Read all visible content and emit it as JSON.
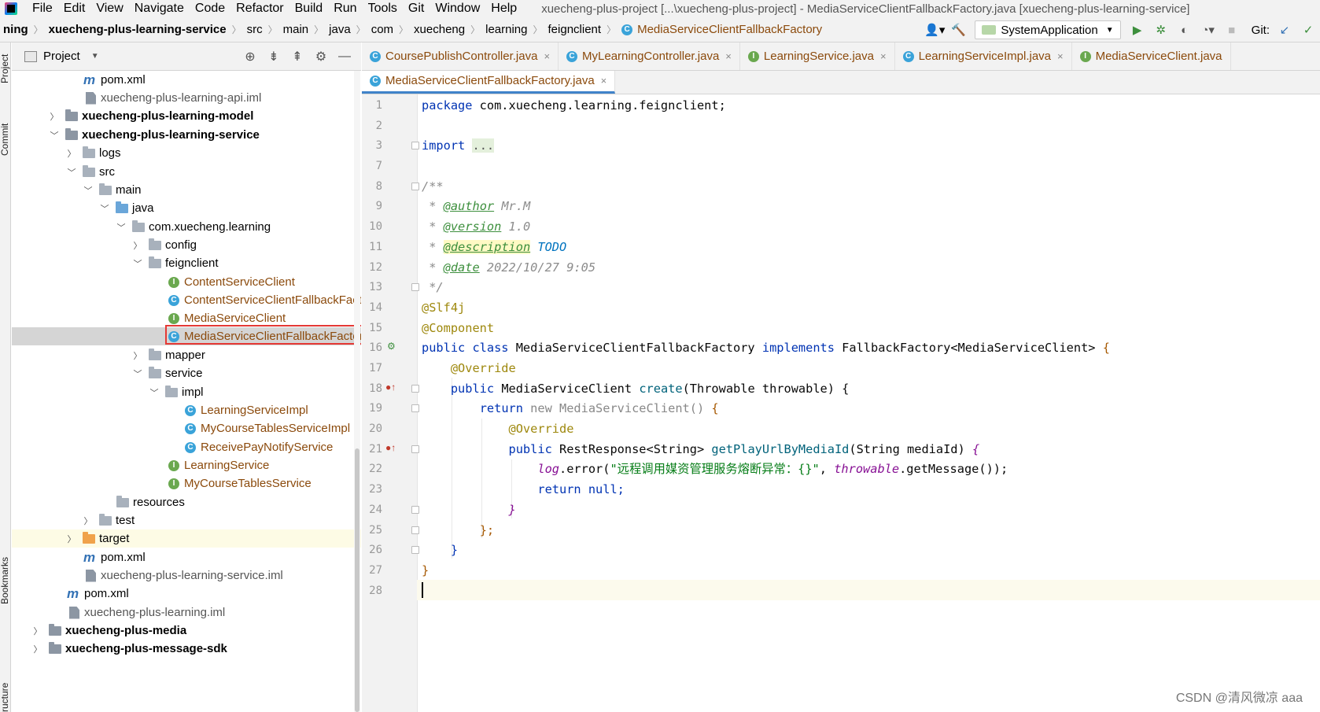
{
  "menubar": {
    "items": [
      "File",
      "Edit",
      "View",
      "Navigate",
      "Code",
      "Refactor",
      "Build",
      "Run",
      "Tools",
      "Git",
      "Window",
      "Help"
    ],
    "window_title": "xuecheng-plus-project [...\\xuecheng-plus-project] - MediaServiceClientFallbackFactory.java [xuecheng-plus-learning-service]"
  },
  "breadcrumb": [
    "ning",
    "xuecheng-plus-learning-service",
    "src",
    "main",
    "java",
    "com",
    "xuecheng",
    "learning",
    "feignclient",
    "MediaServiceClientFallbackFactory"
  ],
  "toolbar": {
    "run_config": "SystemApplication",
    "git_label": "Git:"
  },
  "left_strip": {
    "labels": [
      "Project",
      "Commit",
      "Bookmarks",
      "ructure"
    ]
  },
  "project_panel": {
    "title": "Project"
  },
  "tree": [
    {
      "label": "pom.xml",
      "type": "maven"
    },
    {
      "label": "xuecheng-plus-learning-api.iml",
      "type": "iml"
    },
    {
      "label": "xuecheng-plus-learning-model",
      "type": "module"
    },
    {
      "label": "xuecheng-plus-learning-service",
      "type": "module"
    },
    {
      "label": "logs",
      "type": "folder"
    },
    {
      "label": "src",
      "type": "folder"
    },
    {
      "label": "main",
      "type": "folder"
    },
    {
      "label": "java",
      "type": "src"
    },
    {
      "label": "com.xuecheng.learning",
      "type": "package"
    },
    {
      "label": "config",
      "type": "package"
    },
    {
      "label": "feignclient",
      "type": "package"
    },
    {
      "label": "ContentServiceClient",
      "type": "interface"
    },
    {
      "label": "ContentServiceClientFallbackFact",
      "type": "class"
    },
    {
      "label": "MediaServiceClient",
      "type": "interface"
    },
    {
      "label": "MediaServiceClientFallbackFactor",
      "type": "class"
    },
    {
      "label": "mapper",
      "type": "package"
    },
    {
      "label": "service",
      "type": "package"
    },
    {
      "label": "impl",
      "type": "package"
    },
    {
      "label": "LearningServiceImpl",
      "type": "class"
    },
    {
      "label": "MyCourseTablesServiceImpl",
      "type": "class"
    },
    {
      "label": "ReceivePayNotifyService",
      "type": "class"
    },
    {
      "label": "LearningService",
      "type": "interface"
    },
    {
      "label": "MyCourseTablesService",
      "type": "interface"
    },
    {
      "label": "resources",
      "type": "folder"
    },
    {
      "label": "test",
      "type": "folder"
    },
    {
      "label": "target",
      "type": "excluded"
    },
    {
      "label": "pom.xml",
      "type": "maven"
    },
    {
      "label": "xuecheng-plus-learning-service.iml",
      "type": "iml"
    },
    {
      "label": "pom.xml",
      "type": "maven"
    },
    {
      "label": "xuecheng-plus-learning.iml",
      "type": "iml"
    },
    {
      "label": "xuecheng-plus-media",
      "type": "module"
    },
    {
      "label": "xuecheng-plus-message-sdk",
      "type": "module"
    }
  ],
  "tabs_row1": [
    "CoursePublishController.java",
    "MyLearningController.java",
    "LearningService.java",
    "LearningServiceImpl.java",
    "MediaServiceClient.java"
  ],
  "tabs_row2": [
    "MediaServiceClientFallbackFactory.java"
  ],
  "editor": {
    "line_numbers": [
      "1",
      "2",
      "3",
      "7",
      "8",
      "9",
      "10",
      "11",
      "12",
      "13",
      "14",
      "15",
      "16",
      "17",
      "18",
      "19",
      "20",
      "21",
      "22",
      "23",
      "24",
      "25",
      "26",
      "27",
      "28"
    ],
    "code": {
      "package_kw": "package",
      "package_name": " com.xuecheng.learning.feignclient;",
      "import_kw": "import",
      "import_fold": "...",
      "doc_open": "/**",
      "author_tag": "@author",
      "author_val": " Mr.M",
      "version_tag": "@version",
      "version_val": " 1.0",
      "desc_tag": "@description",
      "desc_val": " TODO",
      "date_tag": "@date",
      "date_val": " 2022/10/27 9:05",
      "doc_close": " */",
      "ann_slf4j": "@Slf4j",
      "ann_component": "@Component",
      "l16_public": "public class",
      "l16_name": " MediaServiceClientFallbackFactory ",
      "l16_impl": "implements",
      "l16_type": " FallbackFactory",
      "l16_generic": "<MediaServiceClient>",
      "l16_brace": " {",
      "ann_override": "@Override",
      "l18_public": "public",
      "l18_type": " MediaServiceClient ",
      "l18_method": "create",
      "l18_params": "(Throwable throwable) {",
      "l19_return": "return",
      "l19_new": " new MediaServiceClient() ",
      "l19_brace": "{",
      "l21_public": "public",
      "l21_type": " RestResponse<String> ",
      "l21_method": "getPlayUrlByMediaId",
      "l21_params": "(String mediaId) ",
      "l21_brace": "{",
      "l22_log": "log",
      "l22_call": ".error(",
      "l22_str": "\"远程调用媒资管理服务熔断异常：{}\"",
      "l22_comma": ", ",
      "l22_throwable": "throwable",
      "l22_rest": ".getMessage());",
      "l23_return": "return",
      "l23_null": " null;",
      "l24_brace": "}",
      "l25_brace": "};",
      "l26_brace": "}",
      "l27_brace": "}"
    }
  },
  "watermark": "CSDN @清风微凉 aaa",
  "colors": {
    "accent": "#4083c9",
    "highlight_box": "#e53935",
    "selected_row": "#d5d5d5"
  }
}
